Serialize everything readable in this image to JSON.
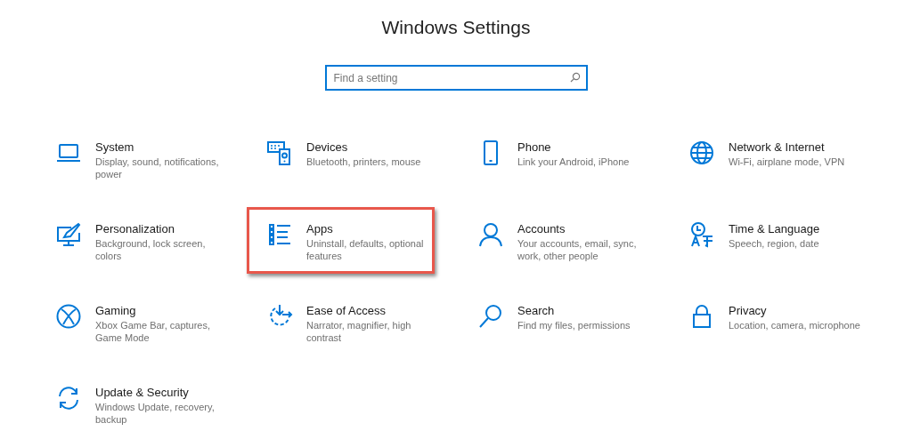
{
  "title": "Windows Settings",
  "search": {
    "placeholder": "Find a setting"
  },
  "tiles": [
    {
      "title": "System",
      "description": "Display, sound, notifications, power",
      "highlighted": false
    },
    {
      "title": "Devices",
      "description": "Bluetooth, printers, mouse",
      "highlighted": false
    },
    {
      "title": "Phone",
      "description": "Link your Android, iPhone",
      "highlighted": false
    },
    {
      "title": "Network & Internet",
      "description": "Wi-Fi, airplane mode, VPN",
      "highlighted": false
    },
    {
      "title": "Personalization",
      "description": "Background, lock screen, colors",
      "highlighted": false
    },
    {
      "title": "Apps",
      "description": "Uninstall, defaults, optional features",
      "highlighted": true
    },
    {
      "title": "Accounts",
      "description": "Your accounts, email, sync, work, other people",
      "highlighted": false
    },
    {
      "title": "Time & Language",
      "description": "Speech, region, date",
      "highlighted": false
    },
    {
      "title": "Gaming",
      "description": "Xbox Game Bar, captures, Game Mode",
      "highlighted": false
    },
    {
      "title": "Ease of Access",
      "description": "Narrator, magnifier, high contrast",
      "highlighted": false
    },
    {
      "title": "Search",
      "description": "Find my files, permissions",
      "highlighted": false
    },
    {
      "title": "Privacy",
      "description": "Location, camera, microphone",
      "highlighted": false
    },
    {
      "title": "Update & Security",
      "description": "Windows Update, recovery, backup",
      "highlighted": false
    }
  ]
}
